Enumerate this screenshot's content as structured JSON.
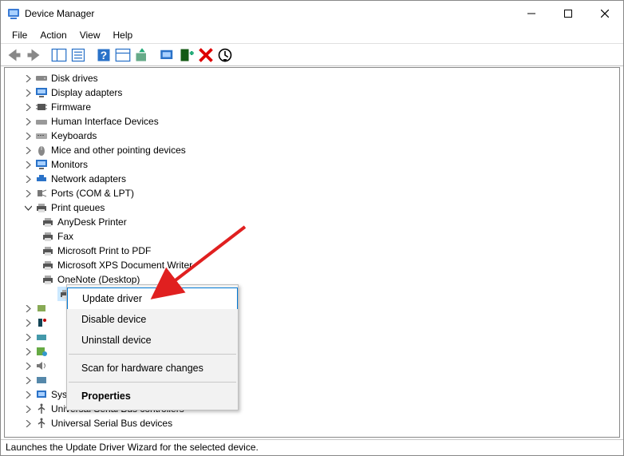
{
  "window": {
    "title": "Device Manager"
  },
  "menu": {
    "file": "File",
    "action": "Action",
    "view": "View",
    "help": "Help"
  },
  "tree": {
    "disk_drives": "Disk drives",
    "display_adapters": "Display adapters",
    "firmware": "Firmware",
    "hid": "Human Interface Devices",
    "keyboards": "Keyboards",
    "mice": "Mice and other pointing devices",
    "monitors": "Monitors",
    "network": "Network adapters",
    "ports": "Ports (COM & LPT)",
    "print_queues": "Print queues",
    "pq": {
      "anydesk": "AnyDesk Printer",
      "fax": "Fax",
      "mspdf": "Microsoft Print to PDF",
      "msxps": "Microsoft XPS Document Writer",
      "onenote": "OneNote (Desktop)"
    },
    "system_devices_obscured": "System devices",
    "usb_controllers": "Universal Serial Bus controllers",
    "usb_devices": "Universal Serial Bus devices"
  },
  "context_menu": {
    "update": "Update driver",
    "disable": "Disable device",
    "uninstall": "Uninstall device",
    "scan": "Scan for hardware changes",
    "properties": "Properties"
  },
  "statusbar": {
    "text": "Launches the Update Driver Wizard for the selected device."
  }
}
